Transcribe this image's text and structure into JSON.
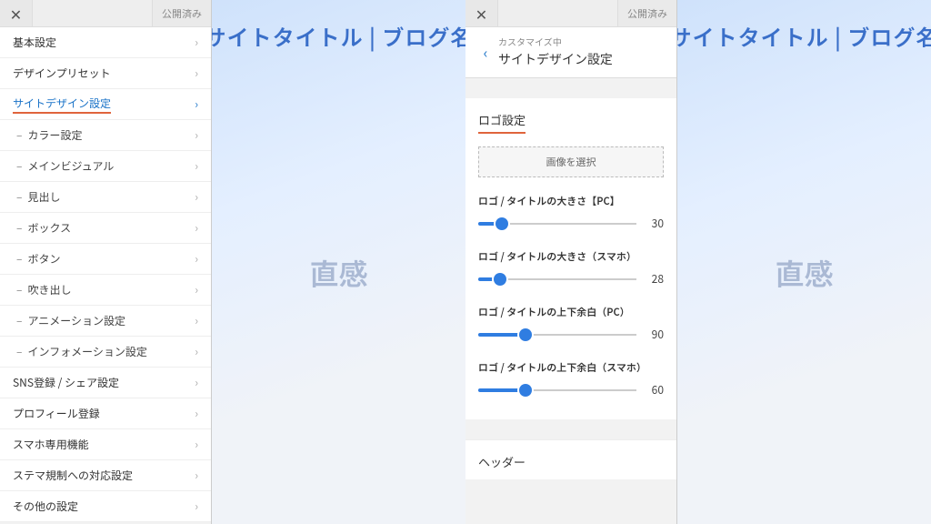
{
  "shared": {
    "status_label": "公開済み",
    "preview_title": "サイトタイトル | ブログ名",
    "preview_hero": "直感"
  },
  "left": {
    "basic": "基本設定",
    "presets": "デザインプリセット",
    "site_design": "サイトデザイン設定",
    "sub": {
      "color": "カラー設定",
      "main_visual": "メインビジュアル",
      "heading": "見出し",
      "box": "ボックス",
      "button": "ボタン",
      "speech": "吹き出し",
      "animation": "アニメーション設定",
      "information": "インフォメーション設定"
    },
    "sns": "SNS登録 / シェア設定",
    "profile": "プロフィール登録",
    "mobile": "スマホ専用機能",
    "stealth": "ステマ規制への対応設定",
    "other": "その他の設定"
  },
  "right": {
    "crumb_k": "カスタマイズ中",
    "crumb_t": "サイトデザイン設定",
    "logo_section": "ロゴ設定",
    "img_select": "画像を選択",
    "sliders": {
      "pc_size": {
        "label": "ロゴ / タイトルの大きさ【PC】",
        "value": 30,
        "min": 0,
        "max": 200
      },
      "sp_size": {
        "label": "ロゴ / タイトルの大きさ（スマホ）",
        "value": 28,
        "min": 0,
        "max": 200
      },
      "pc_padding": {
        "label": "ロゴ / タイトルの上下余白（PC）",
        "value": 90,
        "min": 0,
        "max": 300
      },
      "sp_padding": {
        "label": "ロゴ / タイトルの上下余白（スマホ）",
        "value": 60,
        "min": 0,
        "max": 200
      }
    },
    "header_section": "ヘッダー"
  }
}
